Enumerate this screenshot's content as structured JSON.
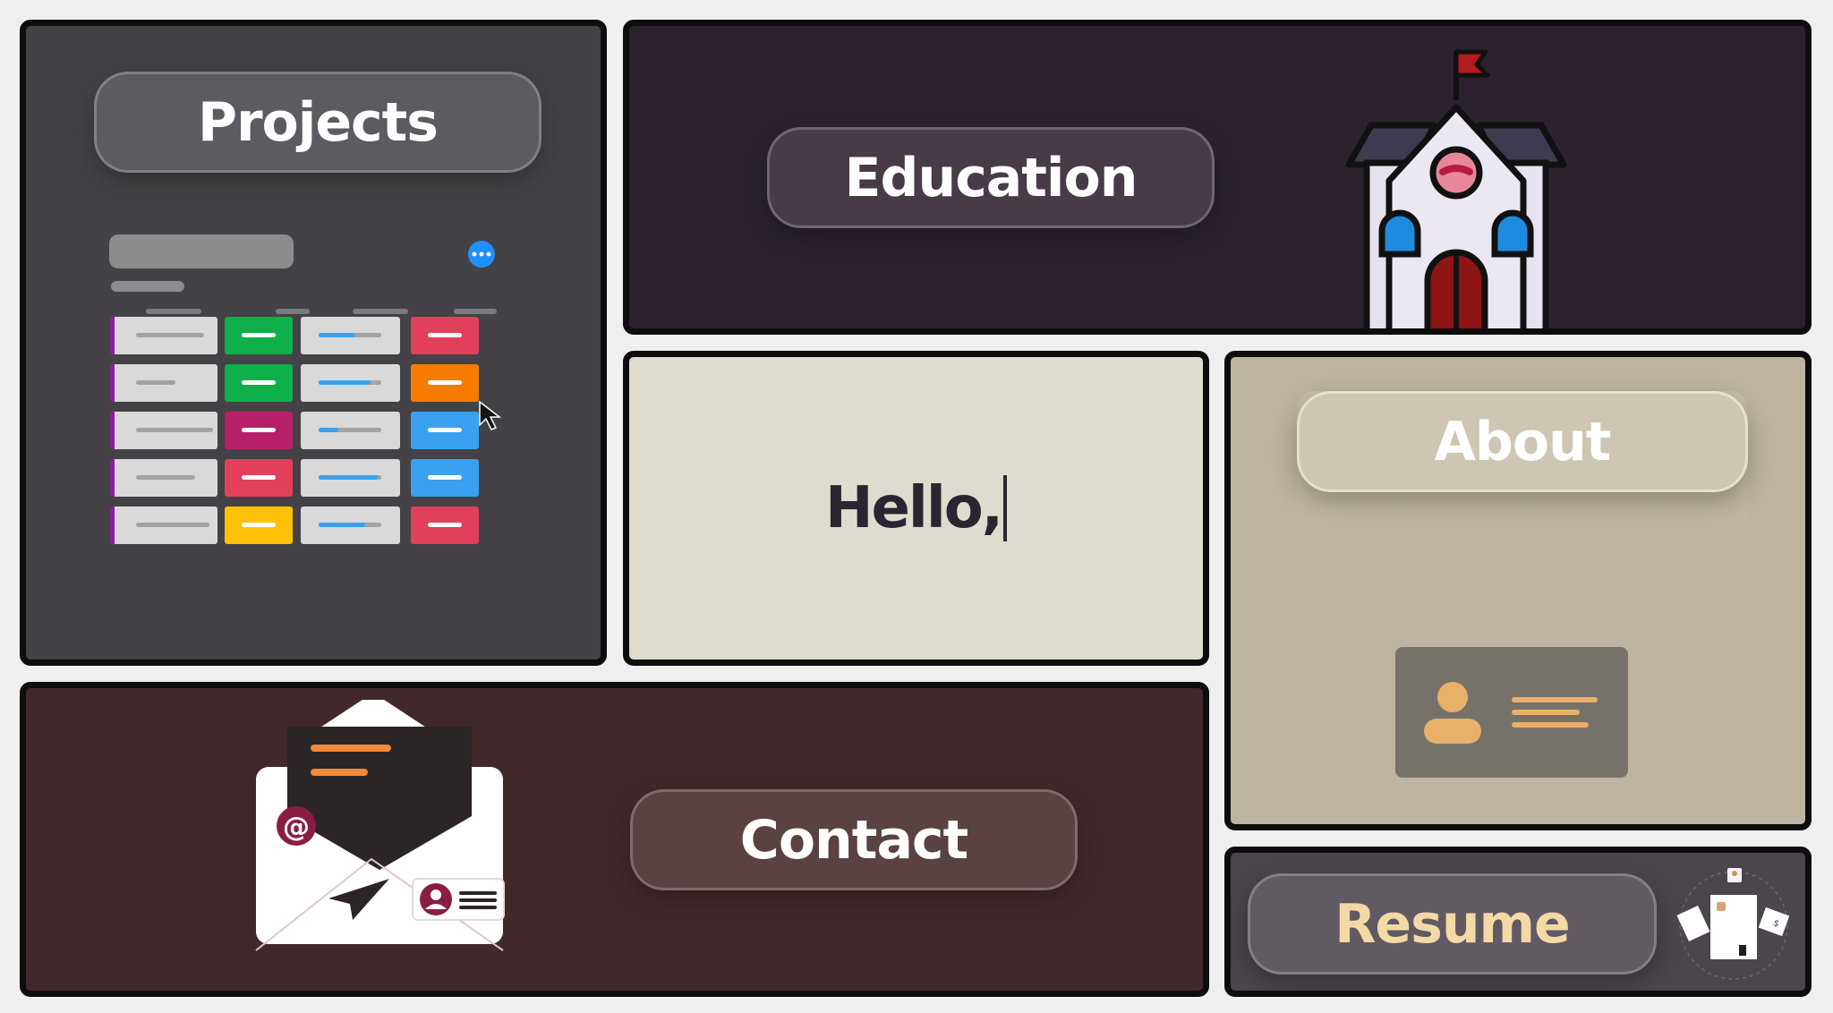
{
  "tiles": {
    "projects": {
      "label": "Projects"
    },
    "education": {
      "label": "Education"
    },
    "hello": {
      "text": "Hello,"
    },
    "about": {
      "label": "About"
    },
    "contact": {
      "label": "Contact"
    },
    "resume": {
      "label": "Resume"
    }
  },
  "icons": {
    "projects": "kanban-board-icon",
    "education": "school-building-icon",
    "about": "id-card-icon",
    "contact": "open-envelope-icon",
    "resume": "resume-documents-icon",
    "cursor": "mouse-pointer-icon",
    "more": "ellipsis-icon"
  },
  "colors": {
    "status_green": "#0db04b",
    "status_red": "#e2405a",
    "status_orange": "#f57c00",
    "status_blue": "#3aa0f0",
    "status_magenta": "#b8206a",
    "status_yellow": "#ffc107",
    "accent_tan": "#e8b06a",
    "resume_text": "#f3d9a6"
  }
}
